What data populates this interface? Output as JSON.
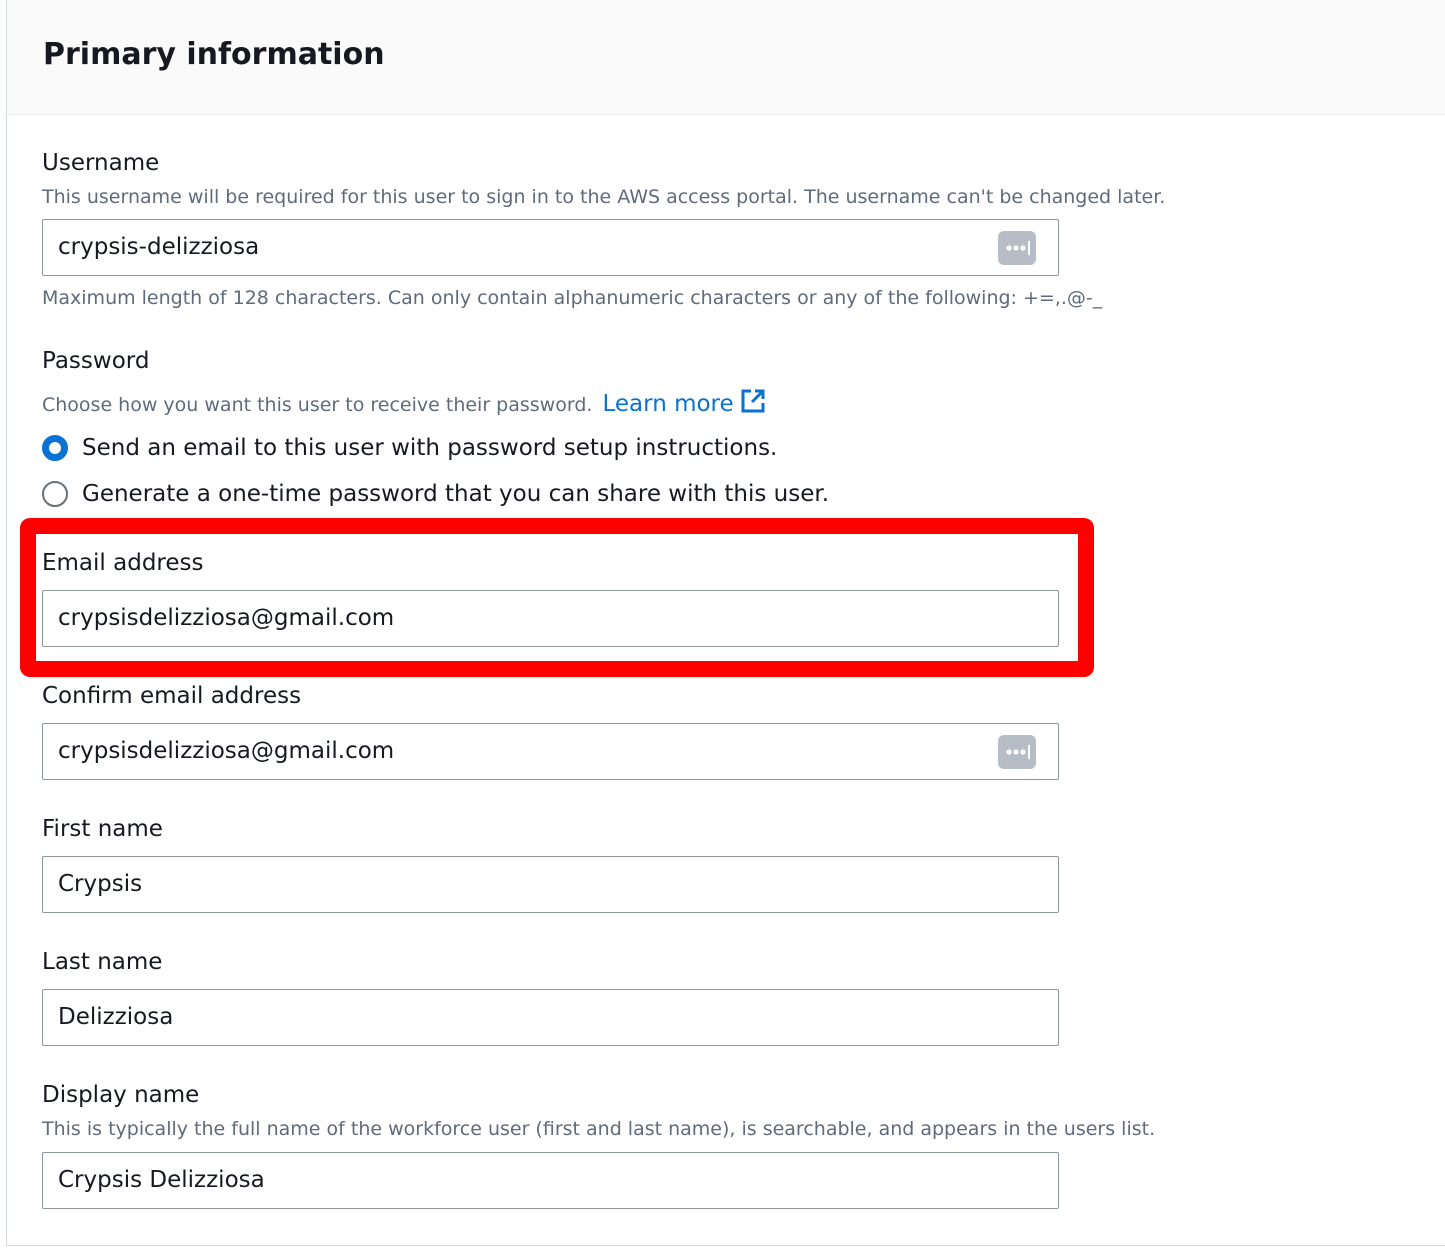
{
  "section": {
    "title": "Primary information"
  },
  "username": {
    "label": "Username",
    "description": "This username will be required for this user to sign in to the AWS access portal. The username can't be changed later.",
    "value": "crypsis-delizziosa",
    "constraint": "Maximum length of 128 characters. Can only contain alphanumeric characters or any of the following: +=,.@-_"
  },
  "password": {
    "label": "Password",
    "description": "Choose how you want this user to receive their password.",
    "learn_more": "Learn more",
    "options": [
      {
        "label": "Send an email to this user with password setup instructions.",
        "selected": true
      },
      {
        "label": "Generate a one-time password that you can share with this user.",
        "selected": false
      }
    ]
  },
  "email": {
    "label": "Email address",
    "value": "crypsisdelizziosa@gmail.com"
  },
  "confirm_email": {
    "label": "Confirm email address",
    "value": "crypsisdelizziosa@gmail.com"
  },
  "first_name": {
    "label": "First name",
    "value": "Crypsis"
  },
  "last_name": {
    "label": "Last name",
    "value": "Delizziosa"
  },
  "display_name": {
    "label": "Display name",
    "description": "This is typically the full name of the workforce user (first and last name), is searchable, and appears in the users list.",
    "value": "Crypsis Delizziosa"
  },
  "colors": {
    "link": "#0972d3",
    "radio_selected": "#0972d3",
    "highlight": "#ff0000",
    "input_border": "#8d9699",
    "description_text": "#5f6b7a"
  },
  "icons": {
    "password_manager": "password-manager-icon",
    "external_link": "external-link-icon"
  }
}
